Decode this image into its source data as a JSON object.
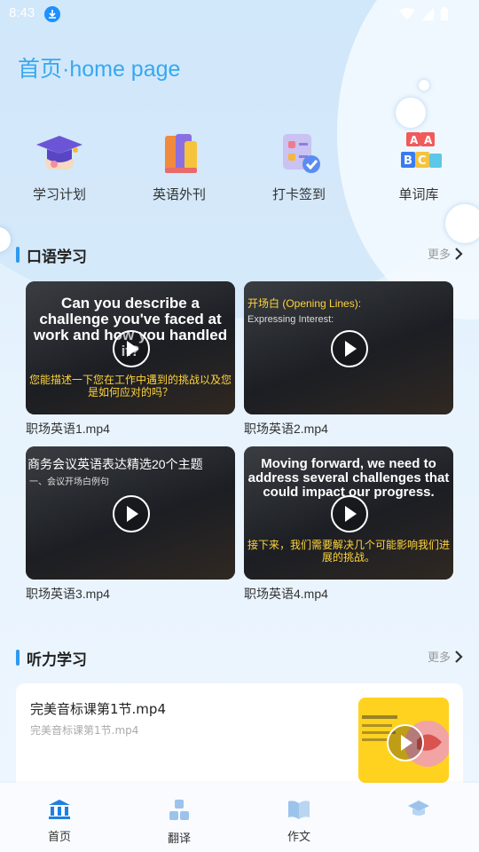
{
  "status": {
    "time": "8:43"
  },
  "header": {
    "title": "首页·home page"
  },
  "quick_actions": [
    {
      "label": "学习计划",
      "icon": "graduation-cap-icon"
    },
    {
      "label": "英语外刊",
      "icon": "books-icon"
    },
    {
      "label": "打卡签到",
      "icon": "checklist-icon"
    },
    {
      "label": "单词库",
      "icon": "abc-blocks-icon"
    }
  ],
  "speaking": {
    "title": "口语学习",
    "more": "更多",
    "videos": [
      {
        "name": "职场英语1.mp4",
        "big": "Can you describe a challenge you've faced at work and how you handled it?",
        "cn": "您能描述一下您在工作中遇到的挑战以及您是如何应对的吗？",
        "small": ""
      },
      {
        "name": "职场英语2.mp4",
        "big": "",
        "cn": "开场白 (Opening Lines):",
        "small": "Expressing Interest:"
      },
      {
        "name": "职场英语3.mp4",
        "big": "",
        "cn": "商务会议英语表达精选20个主题",
        "small": "一、会议开场白例句"
      },
      {
        "name": "职场英语4.mp4",
        "big": "Moving forward, we need to address several challenges that could impact our progress.",
        "cn": "接下来，我们需要解决几个可能影响我们进展的挑战。",
        "small": ""
      }
    ]
  },
  "listening": {
    "title": "听力学习",
    "more": "更多",
    "item": {
      "title": "完美音标课第1节.mp4",
      "subtitle": "完美音标课第1节.mp4"
    }
  },
  "tabs": [
    {
      "label": "首页",
      "icon": "bank-icon",
      "active": true
    },
    {
      "label": "翻译",
      "icon": "abc-icon",
      "active": false
    },
    {
      "label": "作文",
      "icon": "open-book-icon",
      "active": false
    },
    {
      "label": "",
      "icon": "graduation-cap-icon",
      "active": false
    }
  ],
  "colors": {
    "accent": "#2e9af0",
    "title": "#36a8f2",
    "tab_active": "#1f7fe0",
    "tab_inactive": "#9cc3ec"
  }
}
